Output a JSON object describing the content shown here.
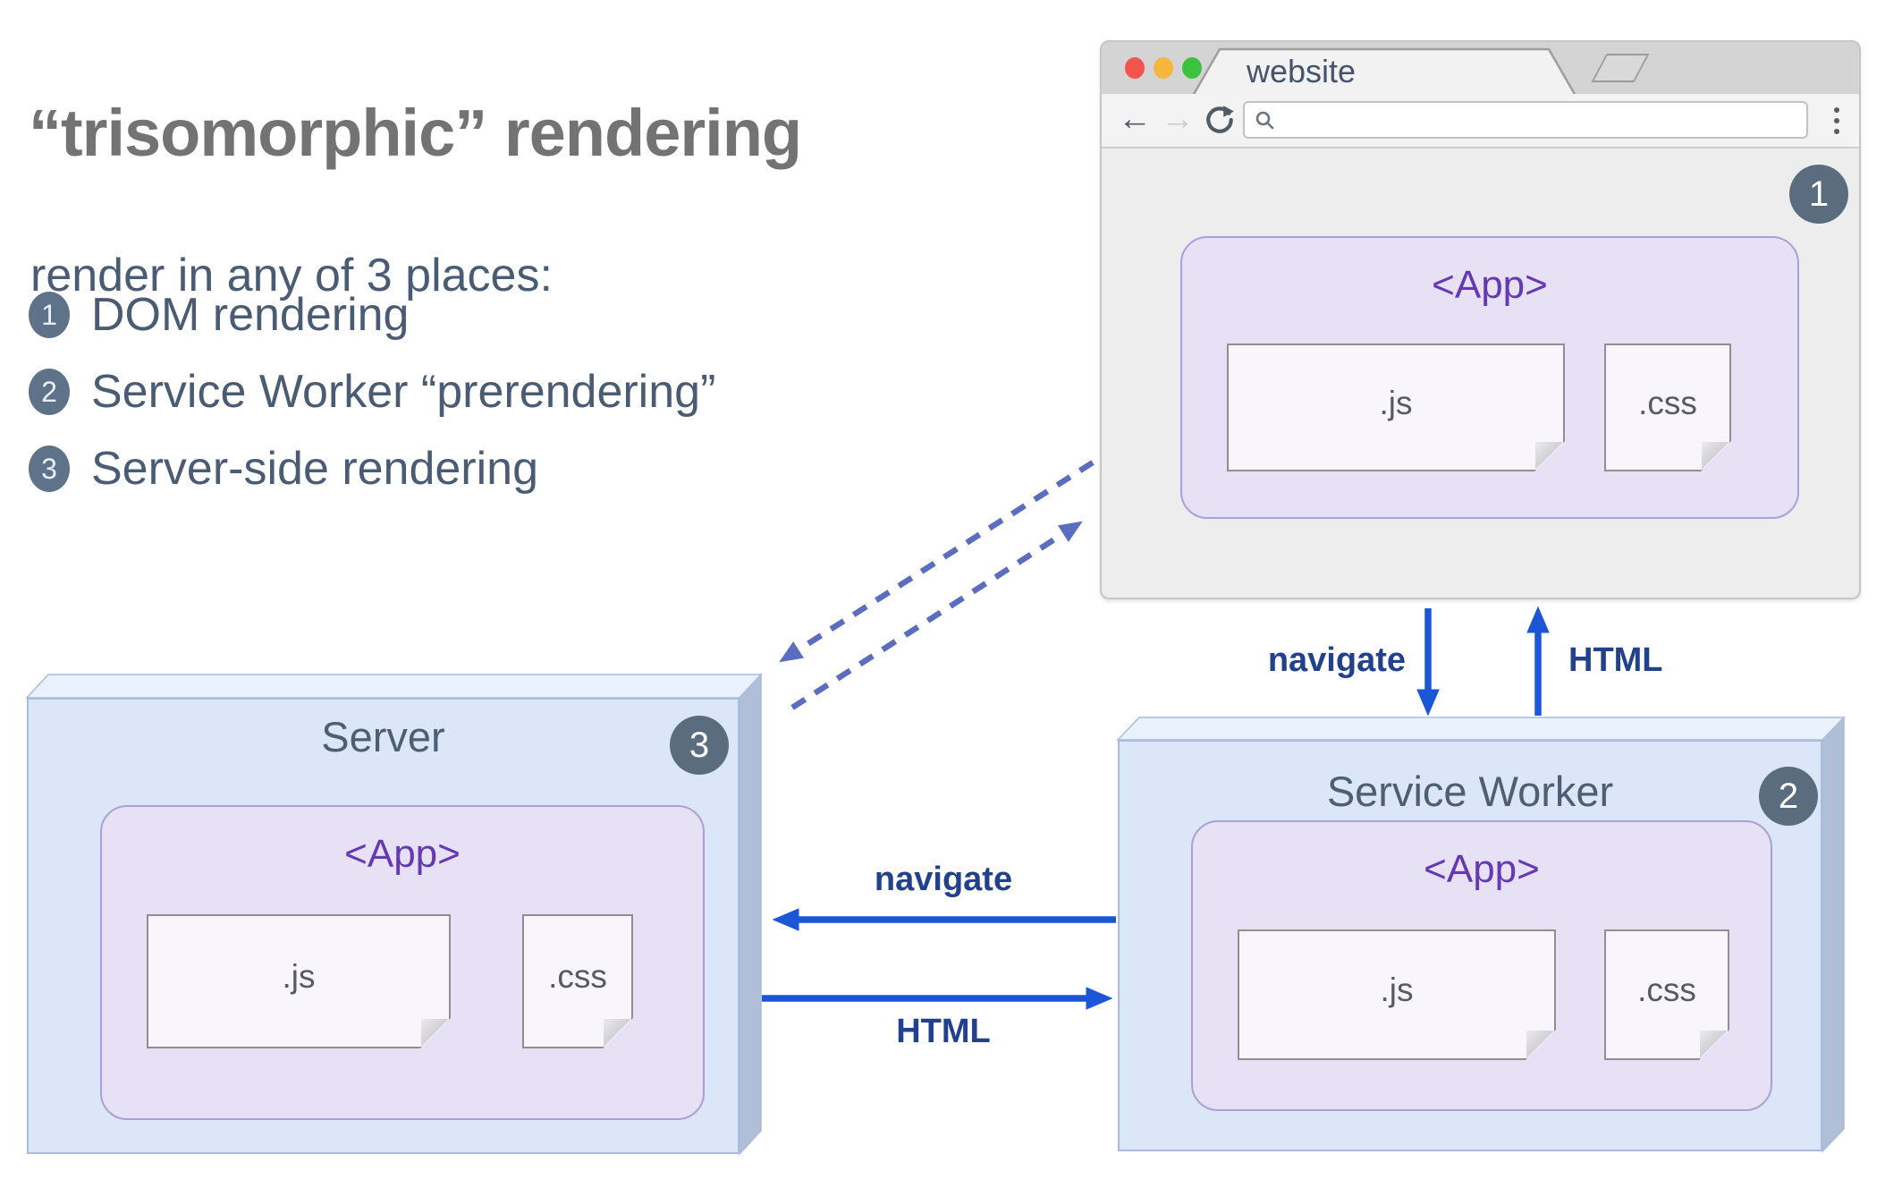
{
  "heading": {
    "title": "“trisomorphic” rendering",
    "subtitle": "render in any of 3 places:",
    "items": [
      {
        "num": "1",
        "label": "DOM rendering"
      },
      {
        "num": "2",
        "label": "Service Worker “prerendering”"
      },
      {
        "num": "3",
        "label": "Server-side rendering"
      }
    ]
  },
  "browser": {
    "tab_title": "website",
    "url_value": "",
    "step_badge": "1",
    "app": {
      "label": "<App>",
      "files": [
        {
          "name": ".js"
        },
        {
          "name": ".css"
        }
      ]
    }
  },
  "server": {
    "title": "Server",
    "step_badge": "3",
    "app": {
      "label": "<App>",
      "files": [
        {
          "name": ".js"
        },
        {
          "name": ".css"
        }
      ]
    }
  },
  "service_worker": {
    "title": "Service Worker",
    "step_badge": "2",
    "app": {
      "label": "<App>",
      "files": [
        {
          "name": ".js"
        },
        {
          "name": ".css"
        }
      ]
    }
  },
  "arrows": {
    "browser_to_sw": "navigate",
    "sw_to_browser": "HTML",
    "sw_to_server": "navigate",
    "server_to_sw": "HTML"
  },
  "colors": {
    "arrow_blue": "#1a56d6",
    "dashed_arrow_blue": "#5b6dc1",
    "arrow_label_navy": "#21418c",
    "app_purple": "#6639b4",
    "box_face_blue": "#dbe7f8",
    "box_top_blue": "#e9f1fc",
    "box_side_blue": "#b1bed8",
    "app_box_lavender": "#e7e1f5",
    "badge_slate": "#5b6c7e",
    "heading_gray": "#737373",
    "body_slate": "#4a5c74",
    "traffic_red": "#f2544e",
    "traffic_yellow": "#f5b63e",
    "traffic_green": "#3cc23f"
  }
}
